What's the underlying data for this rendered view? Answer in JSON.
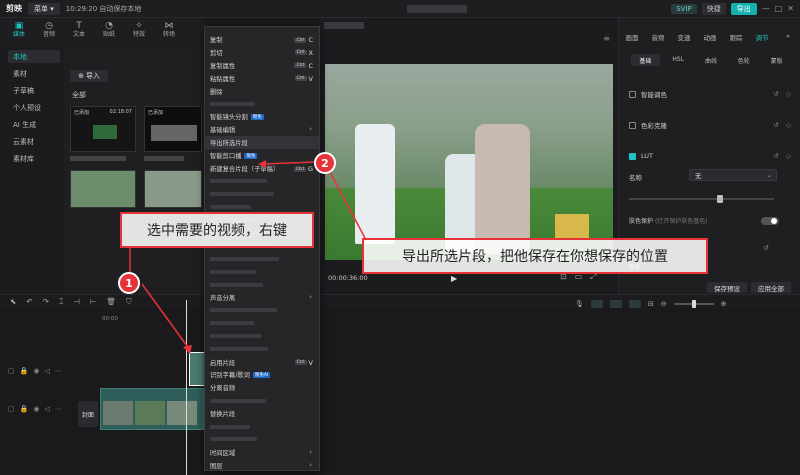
{
  "titlebar": {
    "logo": "剪映",
    "menu": "菜单 ▾",
    "autosave": "10:29:20 自动保存本地",
    "vip": "SVIP",
    "shortcut": "快捷",
    "export": "导出"
  },
  "left_tools": [
    "媒体",
    "音频",
    "文本",
    "贴纸",
    "特效",
    "转场"
  ],
  "left_nav": [
    "本地",
    "素材",
    "子草稿",
    "个人预设",
    "AI 生成",
    "云素材",
    "素材库"
  ],
  "media": {
    "import_label": "导入",
    "all_label": "全部",
    "thumbs": [
      {
        "label": "已添加",
        "duration": "02:18:07"
      },
      {
        "label": "已添加",
        "duration": ""
      },
      {
        "label": "",
        "duration": ""
      },
      {
        "label": "",
        "duration": ""
      }
    ]
  },
  "context_menu": {
    "items": [
      {
        "label": "复制",
        "key": "C",
        "disabled": false
      },
      {
        "label": "剪切",
        "key": "X",
        "disabled": false
      },
      {
        "label": "复制属性",
        "key": "C",
        "disabled": false
      },
      {
        "label": "粘贴属性",
        "key": "V",
        "disabled": false
      },
      {
        "label": "删除",
        "key": "",
        "disabled": false
      },
      {
        "label": "",
        "key": "",
        "disabled": true
      },
      {
        "label": "智能镜头分割",
        "badge": "限免",
        "disabled": false
      },
      {
        "label": "基础编辑",
        "arrow": true,
        "disabled": false
      },
      {
        "label": "导出所选片段",
        "disabled": false,
        "highlight": true
      },
      {
        "label": "智能剪口播",
        "badge": "限免",
        "disabled": false
      },
      {
        "label": "新建复合片段（子草稿）",
        "key": "G",
        "disabled": false
      },
      {
        "label": "",
        "disabled": true
      },
      {
        "label": "",
        "disabled": true
      },
      {
        "label": "",
        "disabled": true
      },
      {
        "label": "",
        "disabled": true
      },
      {
        "label": "",
        "disabled": true
      },
      {
        "label": "",
        "disabled": true
      },
      {
        "label": "",
        "disabled": true
      },
      {
        "label": "",
        "disabled": true
      },
      {
        "label": "",
        "disabled": true
      },
      {
        "label": "声音分离",
        "arrow": true,
        "disabled": false
      },
      {
        "label": "",
        "disabled": true
      },
      {
        "label": "",
        "disabled": true
      },
      {
        "label": "",
        "disabled": true
      },
      {
        "label": "",
        "disabled": true
      },
      {
        "label": "启用片段",
        "key": "V",
        "disabled": false
      },
      {
        "label": "识别字幕/歌词",
        "badge": "限免AI",
        "disabled": false
      },
      {
        "label": "分离音频",
        "disabled": false
      },
      {
        "label": "",
        "disabled": true
      },
      {
        "label": "替换片段",
        "disabled": false
      },
      {
        "label": "",
        "disabled": true
      },
      {
        "label": "",
        "disabled": true
      },
      {
        "label": "时间区域",
        "arrow": true,
        "disabled": false
      },
      {
        "label": "图层",
        "arrow": true,
        "disabled": false
      }
    ]
  },
  "preview": {
    "timecode": "00:00:36:00"
  },
  "right_panel": {
    "tabs": [
      "画面",
      "音频",
      "变速",
      "动画",
      "跟踪",
      "调节"
    ],
    "active_tab": 5,
    "subtabs": [
      "基础",
      "HSL",
      "曲线",
      "色轮",
      "蒙版"
    ],
    "rows": [
      {
        "label": "智能调色"
      },
      {
        "label": "色彩克隆"
      },
      {
        "label": "LUT"
      }
    ],
    "name_label": "名称",
    "name_value": "无",
    "color_protect": "肤色保护",
    "color_protect_hint": "(打开保护肤色基色)",
    "adjust_label": "色彩",
    "save_preset": "保存预设",
    "apply_all": "应用全部"
  },
  "timeline": {
    "ruler": [
      "00:00",
      "",
      "",
      "",
      ""
    ],
    "cover_label": "封面"
  },
  "annotations": {
    "step1_text": "选中需要的视频，右键",
    "step2_text": "导出所选片段，把他保存在你想保存的位置",
    "step1_num": "1",
    "step2_num": "2",
    "color": "#e8323a"
  }
}
